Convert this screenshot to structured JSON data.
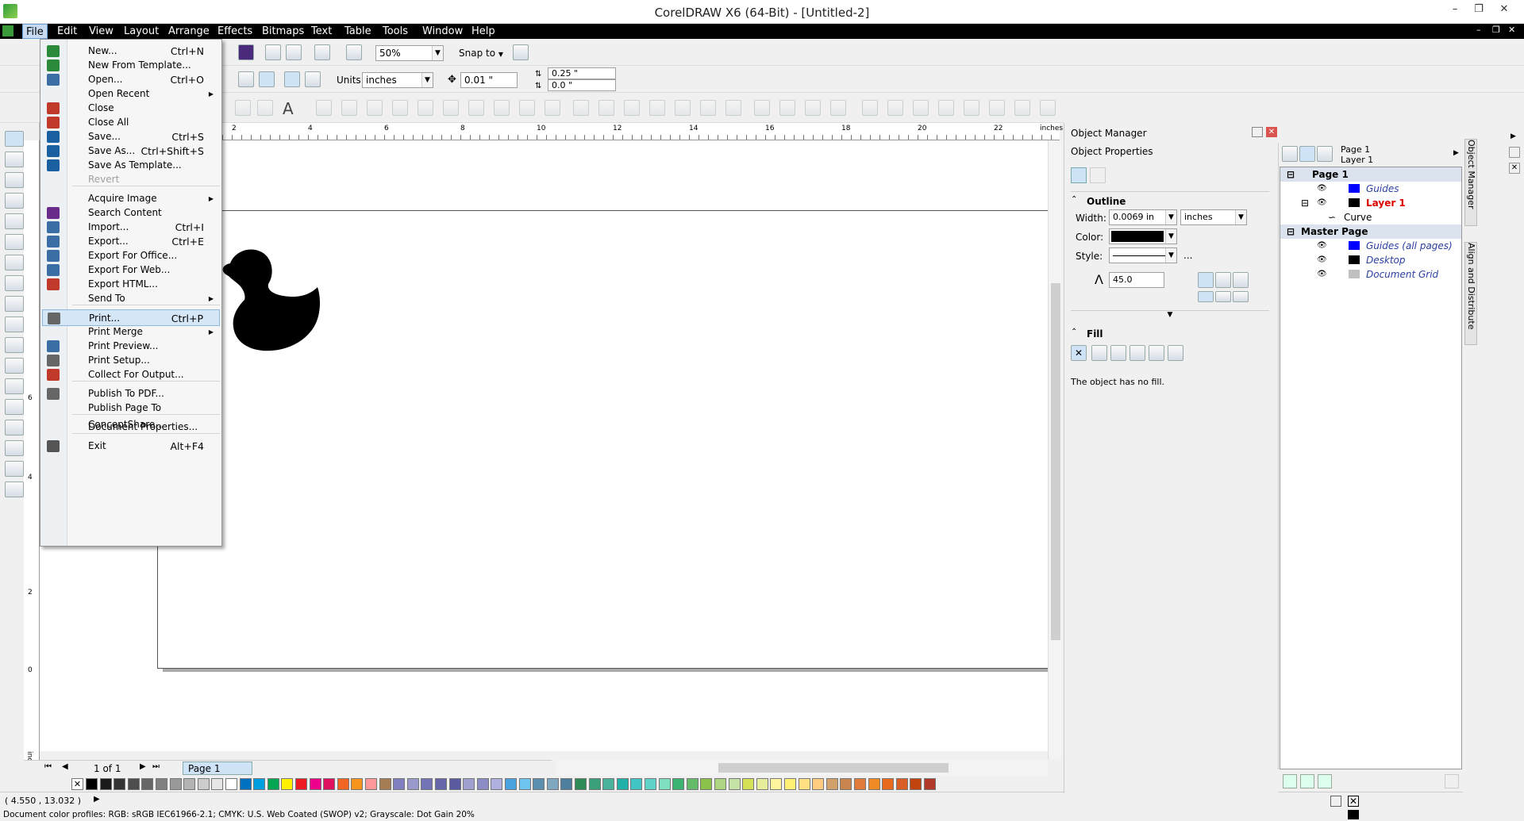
{
  "app": {
    "title": "CorelDRAW X6 (64-Bit) - [Untitled-2]"
  },
  "menubar": [
    "File",
    "Edit",
    "View",
    "Layout",
    "Arrange",
    "Effects",
    "Bitmaps",
    "Text",
    "Table",
    "Tools",
    "Window",
    "Help"
  ],
  "toolbar1": {
    "zoom": "50%",
    "snap_to": "Snap to"
  },
  "toolbar2": {
    "units_label": "Units:",
    "units_value": "inches",
    "nudge": "0.01 \"",
    "dup_x": "0.25 \"",
    "dup_y": "0.0 \""
  },
  "ruler": {
    "h_ticks": [
      "2",
      "4",
      "6",
      "8",
      "10",
      "12",
      "14",
      "16",
      "18",
      "20",
      "22"
    ],
    "h_unit": "inches",
    "v_ticks": [
      "6",
      "4",
      "2",
      "0"
    ],
    "v_unit": "inches"
  },
  "file_menu": {
    "items": [
      {
        "label": "New...",
        "shortcut": "Ctrl+N"
      },
      {
        "label": "New From Template...",
        "shortcut": ""
      },
      {
        "label": "Open...",
        "shortcut": "Ctrl+O"
      },
      {
        "label": "Open Recent",
        "shortcut": "",
        "submenu": true
      },
      {
        "label": "Close",
        "shortcut": ""
      },
      {
        "label": "Close All",
        "shortcut": ""
      },
      {
        "label": "Save...",
        "shortcut": "Ctrl+S"
      },
      {
        "label": "Save As...",
        "shortcut": "Ctrl+Shift+S"
      },
      {
        "label": "Save As Template...",
        "shortcut": ""
      },
      {
        "label": "Revert",
        "shortcut": "",
        "disabled": true
      },
      {
        "label": "Acquire Image",
        "shortcut": "",
        "submenu": true
      },
      {
        "label": "Search Content",
        "shortcut": ""
      },
      {
        "label": "Import...",
        "shortcut": "Ctrl+I"
      },
      {
        "label": "Export...",
        "shortcut": "Ctrl+E"
      },
      {
        "label": "Export For Office...",
        "shortcut": ""
      },
      {
        "label": "Export For Web...",
        "shortcut": ""
      },
      {
        "label": "Export HTML...",
        "shortcut": ""
      },
      {
        "label": "Send To",
        "shortcut": "",
        "submenu": true
      },
      {
        "label": "Print...",
        "shortcut": "Ctrl+P",
        "highlighted": true
      },
      {
        "label": "Print Merge",
        "shortcut": "",
        "submenu": true
      },
      {
        "label": "Print Preview...",
        "shortcut": ""
      },
      {
        "label": "Print Setup...",
        "shortcut": ""
      },
      {
        "label": "Collect For Output...",
        "shortcut": ""
      },
      {
        "label": "Publish To PDF...",
        "shortcut": ""
      },
      {
        "label": "Publish Page To ConceptShare...",
        "shortcut": ""
      },
      {
        "label": "Document Properties...",
        "shortcut": ""
      },
      {
        "label": "Exit",
        "shortcut": "Alt+F4"
      }
    ]
  },
  "page_nav": {
    "count": "1 of 1",
    "tab": "Page 1"
  },
  "status": {
    "coords": "( 4.550 , 13.032 )",
    "profiles": "Document color profiles: RGB: sRGB IEC61966-2.1; CMYK: U.S. Web Coated (SWOP) v2; Grayscale: Dot Gain 20%"
  },
  "docker": {
    "title": "Object Manager",
    "subtitle": "Object Properties",
    "outline": {
      "header": "Outline",
      "width_label": "Width:",
      "width_value": "0.0069 in",
      "width_units": "inches",
      "color_label": "Color:",
      "style_label": "Style:",
      "style_more": "...",
      "miter": "45.0"
    },
    "fill": {
      "header": "Fill",
      "message": "The object has no fill."
    }
  },
  "object_manager": {
    "page_label": "Page 1",
    "layer_label": "Layer 1",
    "tree": [
      {
        "label": "Page 1",
        "type": "header"
      },
      {
        "label": "Guides",
        "type": "layer",
        "swatch": "#0000ff",
        "style": "italic-blue"
      },
      {
        "label": "Layer 1",
        "type": "layer",
        "swatch": "#000000",
        "style": "bold-red"
      },
      {
        "label": "Curve",
        "type": "object"
      },
      {
        "label": "Master Page",
        "type": "header"
      },
      {
        "label": "Guides (all pages)",
        "type": "layer",
        "swatch": "#0000ff",
        "style": "italic-blue"
      },
      {
        "label": "Desktop",
        "type": "layer",
        "swatch": "#000000",
        "style": "italic-blue"
      },
      {
        "label": "Document Grid",
        "type": "layer",
        "swatch": "#c0c0c0",
        "style": "italic-blue"
      }
    ]
  },
  "side_tabs": [
    "Object Manager",
    "Align and Distribute"
  ],
  "palette": [
    "#000000",
    "#1a1a1a",
    "#333333",
    "#4d4d4d",
    "#666666",
    "#808080",
    "#999999",
    "#b3b3b3",
    "#cccccc",
    "#e6e6e6",
    "#ffffff",
    "#0070c0",
    "#00a0e0",
    "#00a651",
    "#fff200",
    "#ed1c24",
    "#ec008c",
    "#e0115f",
    "#f26522",
    "#f7941d",
    "#ff9999",
    "#a67c52",
    "#8080c0",
    "#9999cc",
    "#7373b8",
    "#6666aa",
    "#5a5aa0",
    "#a0a0d0",
    "#8c8cc6",
    "#b0b0e0",
    "#4aa3df",
    "#6ec6f0",
    "#5a8fb0",
    "#7fa7c0",
    "#4f7f9f",
    "#2e8b57",
    "#3aa07a",
    "#48b39a",
    "#20b2aa",
    "#40c4c4",
    "#5fd3c8",
    "#7ee0c0",
    "#3cb371",
    "#66bb6a",
    "#8bc34a",
    "#aed581",
    "#c5e1a5",
    "#d4e157",
    "#e6ee9c",
    "#fff59d",
    "#fff176",
    "#ffe082",
    "#ffcc80",
    "#d2a06a",
    "#c8864e",
    "#e07b39",
    "#f08a24",
    "#e86a1c",
    "#d95f27",
    "#c1440e",
    "#b0392a"
  ]
}
